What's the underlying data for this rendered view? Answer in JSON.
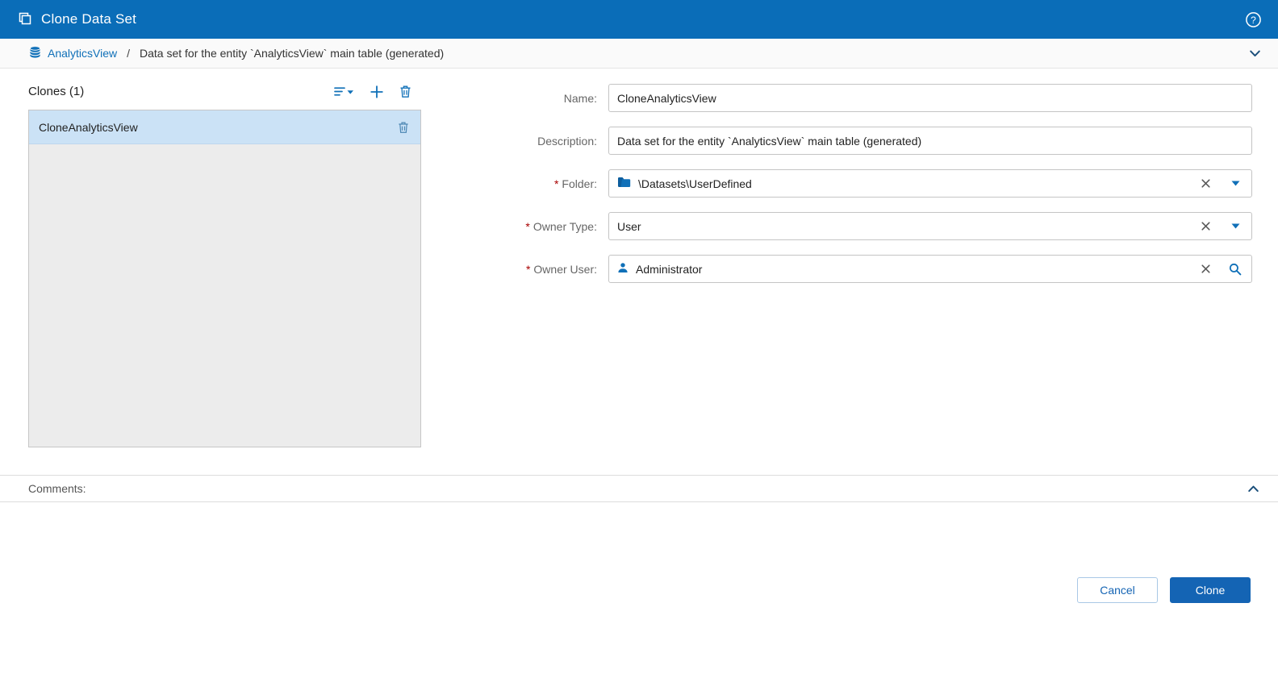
{
  "header": {
    "title": "Clone Data Set"
  },
  "breadcrumb": {
    "entity": "AnalyticsView",
    "separator": "/",
    "current": "Data set for the entity `AnalyticsView` main table (generated)"
  },
  "clones": {
    "title": "Clones (1)",
    "items": [
      {
        "name": "CloneAnalyticsView",
        "selected": true
      }
    ]
  },
  "form": {
    "name": {
      "label": "Name:",
      "value": "CloneAnalyticsView"
    },
    "description": {
      "label": "Description:",
      "value": "Data set for the entity `AnalyticsView` main table (generated)"
    },
    "folder": {
      "label": "Folder:",
      "required": "*",
      "value": "\\Datasets\\UserDefined"
    },
    "owner_type": {
      "label": "Owner Type:",
      "required": "*",
      "value": "User"
    },
    "owner_user": {
      "label": "Owner User:",
      "required": "*",
      "value": "Administrator"
    }
  },
  "comments": {
    "label": "Comments:"
  },
  "footer": {
    "cancel_label": "Cancel",
    "clone_label": "Clone"
  },
  "colors": {
    "titlebar_bg": "#0a6db8",
    "accent": "#1070b8",
    "primary_button": "#1464b4",
    "selected_row": "#cbe2f6",
    "required_marker": "#a80000"
  }
}
